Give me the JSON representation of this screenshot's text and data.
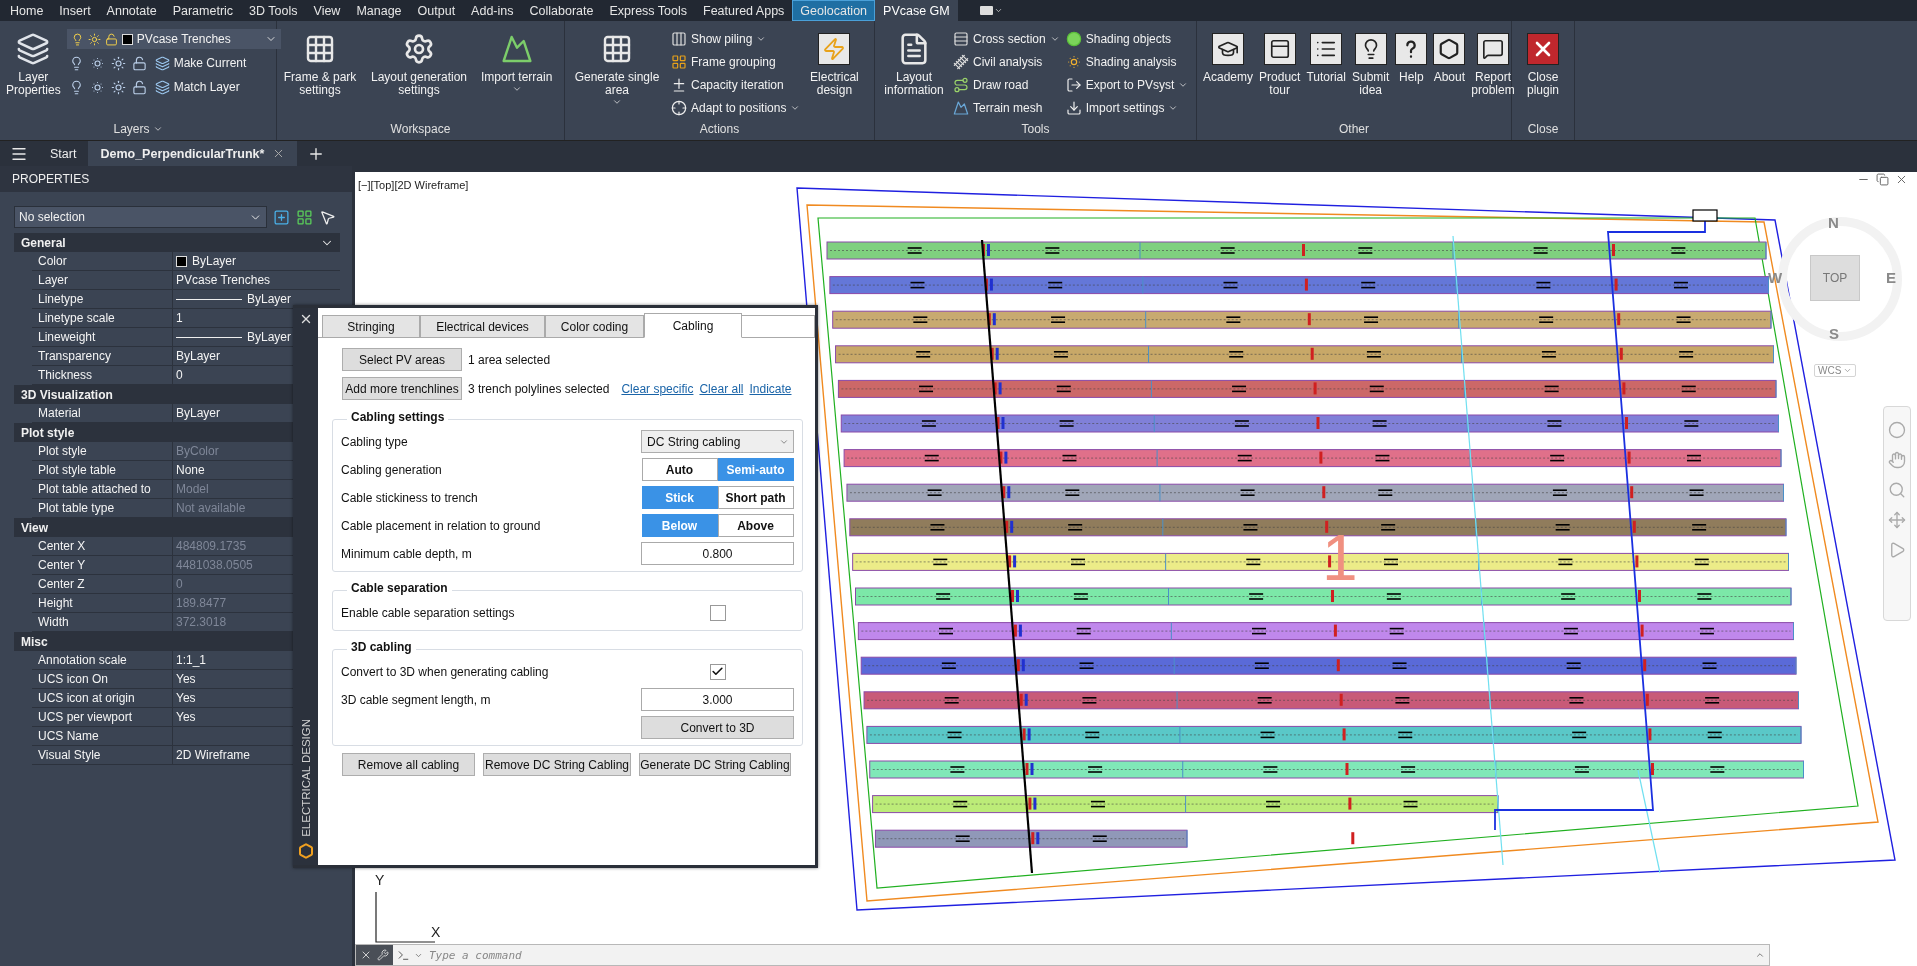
{
  "menu_tabs": [
    {
      "label": "Home",
      "kind": "tab",
      "selected": false
    },
    {
      "label": "Insert",
      "kind": "tab",
      "selected": false
    },
    {
      "label": "Annotate",
      "kind": "tab",
      "selected": false
    },
    {
      "label": "Parametric",
      "kind": "tab",
      "selected": false
    },
    {
      "label": "3D Tools",
      "kind": "tab",
      "selected": false
    },
    {
      "label": "View",
      "kind": "tab",
      "selected": false
    },
    {
      "label": "Manage",
      "kind": "tab",
      "selected": false
    },
    {
      "label": "Output",
      "kind": "tab",
      "selected": false
    },
    {
      "label": "Add-ins",
      "kind": "tab",
      "selected": false
    },
    {
      "label": "Collaborate",
      "kind": "tab",
      "selected": false
    },
    {
      "label": "Express Tools",
      "kind": "tab",
      "selected": false
    },
    {
      "label": "Featured Apps",
      "kind": "tab",
      "selected": false
    },
    {
      "label": "Geolocation",
      "kind": "contextual",
      "selected": false
    },
    {
      "label": "PVcase GM",
      "kind": "tab",
      "selected": true
    }
  ],
  "ribbon": [
    {
      "title": "Layers",
      "dropdown": true,
      "items": [
        {
          "kind": "large",
          "label": "Layer Properties",
          "dropdown": false
        },
        {
          "kind": "layer_combo",
          "value": "PVcase Trenches",
          "commands": [
            "Make Current",
            "Match Layer"
          ]
        }
      ]
    },
    {
      "title": "Workspace",
      "dropdown": false,
      "items": [
        {
          "kind": "large",
          "label": "Frame & park settings",
          "dropdown": false
        },
        {
          "kind": "large",
          "label": "Layout generation settings",
          "dropdown": false
        },
        {
          "kind": "large",
          "label": "Import terrain",
          "dropdown": true
        }
      ]
    },
    {
      "title": "Actions",
      "dropdown": false,
      "items": [
        {
          "kind": "large",
          "label": "Generate single area",
          "dropdown": true
        },
        {
          "kind": "stack",
          "entries": [
            {
              "label": "Show piling",
              "dropdown": true
            },
            {
              "label": "Frame grouping",
              "dropdown": false
            },
            {
              "label": "Capacity iteration",
              "dropdown": false
            },
            {
              "label": "Adapt to positions",
              "dropdown": true
            }
          ]
        },
        {
          "kind": "large",
          "label": "Electrical design",
          "dropdown": false
        }
      ]
    },
    {
      "title": "Tools",
      "dropdown": false,
      "items": [
        {
          "kind": "large",
          "label": "Layout information",
          "dropdown": false
        },
        {
          "kind": "stack",
          "entries": [
            {
              "label": "Cross section",
              "dropdown": true
            },
            {
              "label": "Civil analysis",
              "dropdown": false
            },
            {
              "label": "Draw road",
              "dropdown": false
            },
            {
              "label": "Terrain mesh",
              "dropdown": false
            }
          ]
        },
        {
          "kind": "stack",
          "entries": [
            {
              "label": "Shading objects",
              "dropdown": false
            },
            {
              "label": "Shading analysis",
              "dropdown": false
            },
            {
              "label": "Export to PVsyst",
              "dropdown": true
            },
            {
              "label": "Import settings",
              "dropdown": true
            }
          ]
        }
      ]
    },
    {
      "title": "Other",
      "dropdown": false,
      "items": [
        {
          "kind": "tile",
          "label": "Academy"
        },
        {
          "kind": "tile",
          "label": "Product tour"
        },
        {
          "kind": "tile",
          "label": "Tutorial"
        },
        {
          "kind": "tile",
          "label": "Submit idea"
        },
        {
          "kind": "tile",
          "label": "Help"
        },
        {
          "kind": "tile",
          "label": "About"
        },
        {
          "kind": "tile",
          "label": "Report problem"
        }
      ]
    },
    {
      "title": "Close",
      "dropdown": false,
      "items": [
        {
          "kind": "danger_tile",
          "label": "Close plugin"
        }
      ]
    }
  ],
  "file_tabs": [
    {
      "label": "Start",
      "selected": false,
      "closable": false
    },
    {
      "label": "Demo_PerpendicularTrunk*",
      "selected": true,
      "closable": true
    }
  ],
  "properties": {
    "title": "PROPERTIES",
    "selection": "No selection",
    "sections": [
      {
        "title": "General",
        "expanded": true,
        "rows": [
          {
            "label": "Color",
            "value": "ByLayer",
            "kind": "color",
            "disabled": false
          },
          {
            "label": "Layer",
            "value": "PVcase Trenches",
            "kind": "text",
            "disabled": false
          },
          {
            "label": "Linetype",
            "value": "ByLayer",
            "kind": "line",
            "disabled": false
          },
          {
            "label": "Linetype scale",
            "value": "1",
            "kind": "text",
            "disabled": false
          },
          {
            "label": "Lineweight",
            "value": "ByLayer",
            "kind": "line",
            "disabled": false
          },
          {
            "label": "Transparency",
            "value": "ByLayer",
            "kind": "text",
            "disabled": false
          },
          {
            "label": "Thickness",
            "value": "0",
            "kind": "text",
            "disabled": false
          }
        ]
      },
      {
        "title": "3D Visualization",
        "rows": [
          {
            "label": "Material",
            "value": "ByLayer",
            "kind": "text",
            "disabled": false
          }
        ]
      },
      {
        "title": "Plot style",
        "rows": [
          {
            "label": "Plot style",
            "value": "ByColor",
            "kind": "text",
            "disabled": true
          },
          {
            "label": "Plot style table",
            "value": "None",
            "kind": "text",
            "disabled": false
          },
          {
            "label": "Plot table attached to",
            "value": "Model",
            "kind": "text",
            "disabled": true
          },
          {
            "label": "Plot table type",
            "value": "Not available",
            "kind": "text",
            "disabled": true
          }
        ]
      },
      {
        "title": "View",
        "rows": [
          {
            "label": "Center X",
            "value": "484809.1735",
            "kind": "text",
            "disabled": true
          },
          {
            "label": "Center Y",
            "value": "4481038.0505",
            "kind": "text",
            "disabled": true
          },
          {
            "label": "Center Z",
            "value": "0",
            "kind": "text",
            "disabled": true
          },
          {
            "label": "Height",
            "value": "189.8477",
            "kind": "text",
            "disabled": true
          },
          {
            "label": "Width",
            "value": "372.3018",
            "kind": "text",
            "disabled": true
          }
        ]
      },
      {
        "title": "Misc",
        "rows": [
          {
            "label": "Annotation scale",
            "value": "1:1_1",
            "kind": "text",
            "disabled": false
          },
          {
            "label": "UCS icon On",
            "value": "Yes",
            "kind": "text",
            "disabled": false
          },
          {
            "label": "UCS icon at origin",
            "value": "Yes",
            "kind": "text",
            "disabled": false
          },
          {
            "label": "UCS per viewport",
            "value": "Yes",
            "kind": "text",
            "disabled": false
          },
          {
            "label": "UCS Name",
            "kind": "text"
          },
          {
            "label": "Visual Style",
            "value": "2D Wireframe",
            "kind": "text",
            "disabled": false
          }
        ]
      }
    ]
  },
  "viewport": {
    "label": "[−][Top][2D Wireframe]",
    "drawing_label": "1",
    "viewcube": {
      "face": "TOP",
      "north": "N",
      "east": "E",
      "south": "S",
      "west": "W",
      "coordinate_system": "WCS"
    },
    "ucs": {
      "x": "X",
      "y": "Y"
    },
    "command": {
      "placeholder": "Type a command"
    }
  },
  "dialog": {
    "side_title": "ELECTRICAL DESIGN",
    "tabs": [
      {
        "label": "Stringing",
        "selected": false
      },
      {
        "label": "Electrical devices",
        "selected": false
      },
      {
        "label": "Color coding",
        "selected": false
      },
      {
        "label": "Cabling",
        "selected": true
      }
    ],
    "selectors": [
      {
        "button": "Select PV areas",
        "status": "1 area selected"
      },
      {
        "button": "Add more trenchlines",
        "status": "3 trench polylines selected",
        "links": [
          "Clear specific",
          "Clear all",
          "Indicate"
        ]
      }
    ],
    "groups": [
      {
        "title": "Cabling settings",
        "rows": [
          {
            "kind": "select",
            "label": "Cabling type",
            "value": "DC String cabling"
          },
          {
            "kind": "toggle",
            "label": "Cabling generation",
            "options": [
              {
                "label": "Auto",
                "selected": false
              },
              {
                "label": "Semi-auto",
                "selected": true
              }
            ]
          },
          {
            "kind": "toggle",
            "label": "Cable stickiness to trench",
            "options": [
              {
                "label": "Stick",
                "selected": true
              },
              {
                "label": "Short path",
                "selected": false
              }
            ]
          },
          {
            "kind": "toggle",
            "label": "Cable placement in relation to ground",
            "options": [
              {
                "label": "Below",
                "selected": true
              },
              {
                "label": "Above",
                "selected": false
              }
            ]
          },
          {
            "kind": "number",
            "label": "Minimum cable depth, m",
            "value": "0.800"
          }
        ]
      },
      {
        "title": "Cable separation",
        "rows": [
          {
            "kind": "checkbox",
            "label": "Enable cable separation settings",
            "checked": false
          }
        ]
      },
      {
        "title": "3D cabling",
        "rows": [
          {
            "kind": "checkbox",
            "label": "Convert to 3D when generating cabling",
            "checked": true
          },
          {
            "kind": "number",
            "label": "3D cable segment length, m",
            "value": "3.000"
          },
          {
            "kind": "button",
            "label": "Convert to 3D"
          }
        ]
      }
    ],
    "actions": [
      "Remove all cabling",
      "Remove DC String Cabling",
      "Generate DC String Cabling"
    ]
  }
}
